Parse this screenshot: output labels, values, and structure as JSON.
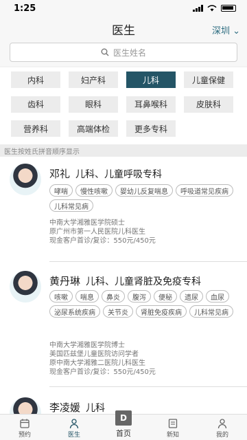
{
  "status": {
    "time": "1:25"
  },
  "header": {
    "title": "医生",
    "city": "深圳"
  },
  "search": {
    "placeholder": "医生姓名"
  },
  "departments": [
    {
      "label": "内科"
    },
    {
      "label": "妇产科"
    },
    {
      "label": "儿科"
    },
    {
      "label": "儿童保健"
    },
    {
      "label": "齿科"
    },
    {
      "label": "眼科"
    },
    {
      "label": "耳鼻喉科"
    },
    {
      "label": "皮肤科"
    },
    {
      "label": "营养科"
    },
    {
      "label": "高端体检"
    },
    {
      "label": "更多专科"
    }
  ],
  "active_department": "儿科",
  "list_hint": "医生按姓氏拼音顺序显示",
  "doctors": [
    {
      "name": "邓礼",
      "specialty": "儿科、儿童呼吸专科",
      "tags": [
        "哮喘",
        "慢性咳嗽",
        "婴幼儿反复喘息",
        "呼吸道常见疾病",
        "儿科常见病"
      ],
      "info1": "中南大学湘雅医学院硕士",
      "info2": "原广州市第一人民医院儿科医生",
      "info3": "现金客户首诊/复诊：550元/450元"
    },
    {
      "name": "黄丹琳",
      "specialty": "儿科、儿童肾脏及免疫专科",
      "tags": [
        "咳嗽",
        "喘息",
        "鼻炎",
        "腹泻",
        "便秘",
        "遗尿",
        "血尿",
        "泌尿系统疾病",
        "关节炎",
        "肾脏免疫疾病",
        "儿科常见病"
      ],
      "info1": "中南大学湘雅医学院博士",
      "info2": "美国匹兹堡儿童医院访问学者",
      "info3": "原中南大学湘雅二医院儿科医生",
      "info4": "现金客户首诊/复诊：550元/450元"
    },
    {
      "name": "李凌媛",
      "specialty": "儿科"
    }
  ],
  "tabs": [
    {
      "label": "预约",
      "icon": "calendar-icon"
    },
    {
      "label": "医生",
      "icon": "doctor-icon"
    },
    {
      "label": "首页",
      "icon": "home-icon",
      "badge": "D"
    },
    {
      "label": "新知",
      "icon": "news-icon"
    },
    {
      "label": "我的",
      "icon": "profile-icon"
    }
  ],
  "colors": {
    "accent": "#245566",
    "city": "#2b6b7f"
  }
}
